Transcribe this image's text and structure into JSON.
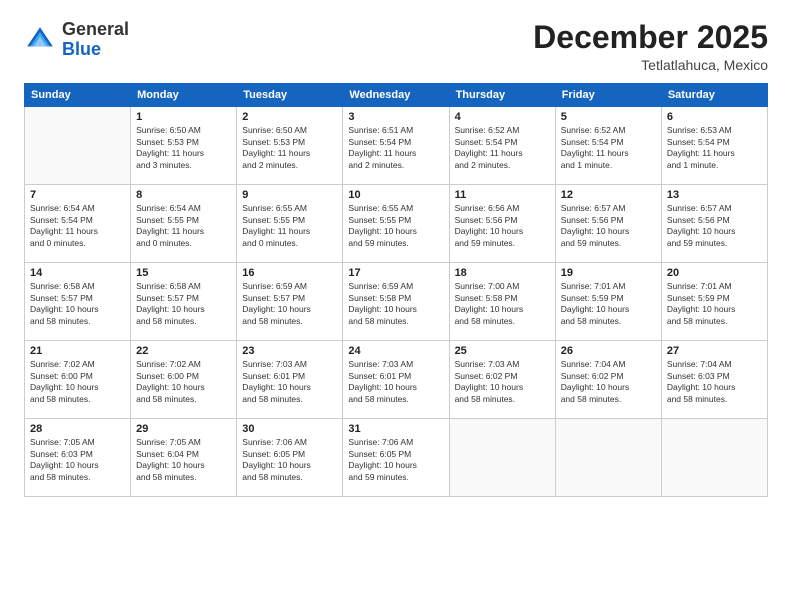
{
  "logo": {
    "general": "General",
    "blue": "Blue"
  },
  "header": {
    "month": "December 2025",
    "location": "Tetlatlahuca, Mexico"
  },
  "weekdays": [
    "Sunday",
    "Monday",
    "Tuesday",
    "Wednesday",
    "Thursday",
    "Friday",
    "Saturday"
  ],
  "weeks": [
    [
      {
        "day": "",
        "info": ""
      },
      {
        "day": "1",
        "info": "Sunrise: 6:50 AM\nSunset: 5:53 PM\nDaylight: 11 hours\nand 3 minutes."
      },
      {
        "day": "2",
        "info": "Sunrise: 6:50 AM\nSunset: 5:53 PM\nDaylight: 11 hours\nand 2 minutes."
      },
      {
        "day": "3",
        "info": "Sunrise: 6:51 AM\nSunset: 5:54 PM\nDaylight: 11 hours\nand 2 minutes."
      },
      {
        "day": "4",
        "info": "Sunrise: 6:52 AM\nSunset: 5:54 PM\nDaylight: 11 hours\nand 2 minutes."
      },
      {
        "day": "5",
        "info": "Sunrise: 6:52 AM\nSunset: 5:54 PM\nDaylight: 11 hours\nand 1 minute."
      },
      {
        "day": "6",
        "info": "Sunrise: 6:53 AM\nSunset: 5:54 PM\nDaylight: 11 hours\nand 1 minute."
      }
    ],
    [
      {
        "day": "7",
        "info": "Sunrise: 6:54 AM\nSunset: 5:54 PM\nDaylight: 11 hours\nand 0 minutes."
      },
      {
        "day": "8",
        "info": "Sunrise: 6:54 AM\nSunset: 5:55 PM\nDaylight: 11 hours\nand 0 minutes."
      },
      {
        "day": "9",
        "info": "Sunrise: 6:55 AM\nSunset: 5:55 PM\nDaylight: 11 hours\nand 0 minutes."
      },
      {
        "day": "10",
        "info": "Sunrise: 6:55 AM\nSunset: 5:55 PM\nDaylight: 10 hours\nand 59 minutes."
      },
      {
        "day": "11",
        "info": "Sunrise: 6:56 AM\nSunset: 5:56 PM\nDaylight: 10 hours\nand 59 minutes."
      },
      {
        "day": "12",
        "info": "Sunrise: 6:57 AM\nSunset: 5:56 PM\nDaylight: 10 hours\nand 59 minutes."
      },
      {
        "day": "13",
        "info": "Sunrise: 6:57 AM\nSunset: 5:56 PM\nDaylight: 10 hours\nand 59 minutes."
      }
    ],
    [
      {
        "day": "14",
        "info": "Sunrise: 6:58 AM\nSunset: 5:57 PM\nDaylight: 10 hours\nand 58 minutes."
      },
      {
        "day": "15",
        "info": "Sunrise: 6:58 AM\nSunset: 5:57 PM\nDaylight: 10 hours\nand 58 minutes."
      },
      {
        "day": "16",
        "info": "Sunrise: 6:59 AM\nSunset: 5:57 PM\nDaylight: 10 hours\nand 58 minutes."
      },
      {
        "day": "17",
        "info": "Sunrise: 6:59 AM\nSunset: 5:58 PM\nDaylight: 10 hours\nand 58 minutes."
      },
      {
        "day": "18",
        "info": "Sunrise: 7:00 AM\nSunset: 5:58 PM\nDaylight: 10 hours\nand 58 minutes."
      },
      {
        "day": "19",
        "info": "Sunrise: 7:01 AM\nSunset: 5:59 PM\nDaylight: 10 hours\nand 58 minutes."
      },
      {
        "day": "20",
        "info": "Sunrise: 7:01 AM\nSunset: 5:59 PM\nDaylight: 10 hours\nand 58 minutes."
      }
    ],
    [
      {
        "day": "21",
        "info": "Sunrise: 7:02 AM\nSunset: 6:00 PM\nDaylight: 10 hours\nand 58 minutes."
      },
      {
        "day": "22",
        "info": "Sunrise: 7:02 AM\nSunset: 6:00 PM\nDaylight: 10 hours\nand 58 minutes."
      },
      {
        "day": "23",
        "info": "Sunrise: 7:03 AM\nSunset: 6:01 PM\nDaylight: 10 hours\nand 58 minutes."
      },
      {
        "day": "24",
        "info": "Sunrise: 7:03 AM\nSunset: 6:01 PM\nDaylight: 10 hours\nand 58 minutes."
      },
      {
        "day": "25",
        "info": "Sunrise: 7:03 AM\nSunset: 6:02 PM\nDaylight: 10 hours\nand 58 minutes."
      },
      {
        "day": "26",
        "info": "Sunrise: 7:04 AM\nSunset: 6:02 PM\nDaylight: 10 hours\nand 58 minutes."
      },
      {
        "day": "27",
        "info": "Sunrise: 7:04 AM\nSunset: 6:03 PM\nDaylight: 10 hours\nand 58 minutes."
      }
    ],
    [
      {
        "day": "28",
        "info": "Sunrise: 7:05 AM\nSunset: 6:03 PM\nDaylight: 10 hours\nand 58 minutes."
      },
      {
        "day": "29",
        "info": "Sunrise: 7:05 AM\nSunset: 6:04 PM\nDaylight: 10 hours\nand 58 minutes."
      },
      {
        "day": "30",
        "info": "Sunrise: 7:06 AM\nSunset: 6:05 PM\nDaylight: 10 hours\nand 58 minutes."
      },
      {
        "day": "31",
        "info": "Sunrise: 7:06 AM\nSunset: 6:05 PM\nDaylight: 10 hours\nand 59 minutes."
      },
      {
        "day": "",
        "info": ""
      },
      {
        "day": "",
        "info": ""
      },
      {
        "day": "",
        "info": ""
      }
    ]
  ]
}
